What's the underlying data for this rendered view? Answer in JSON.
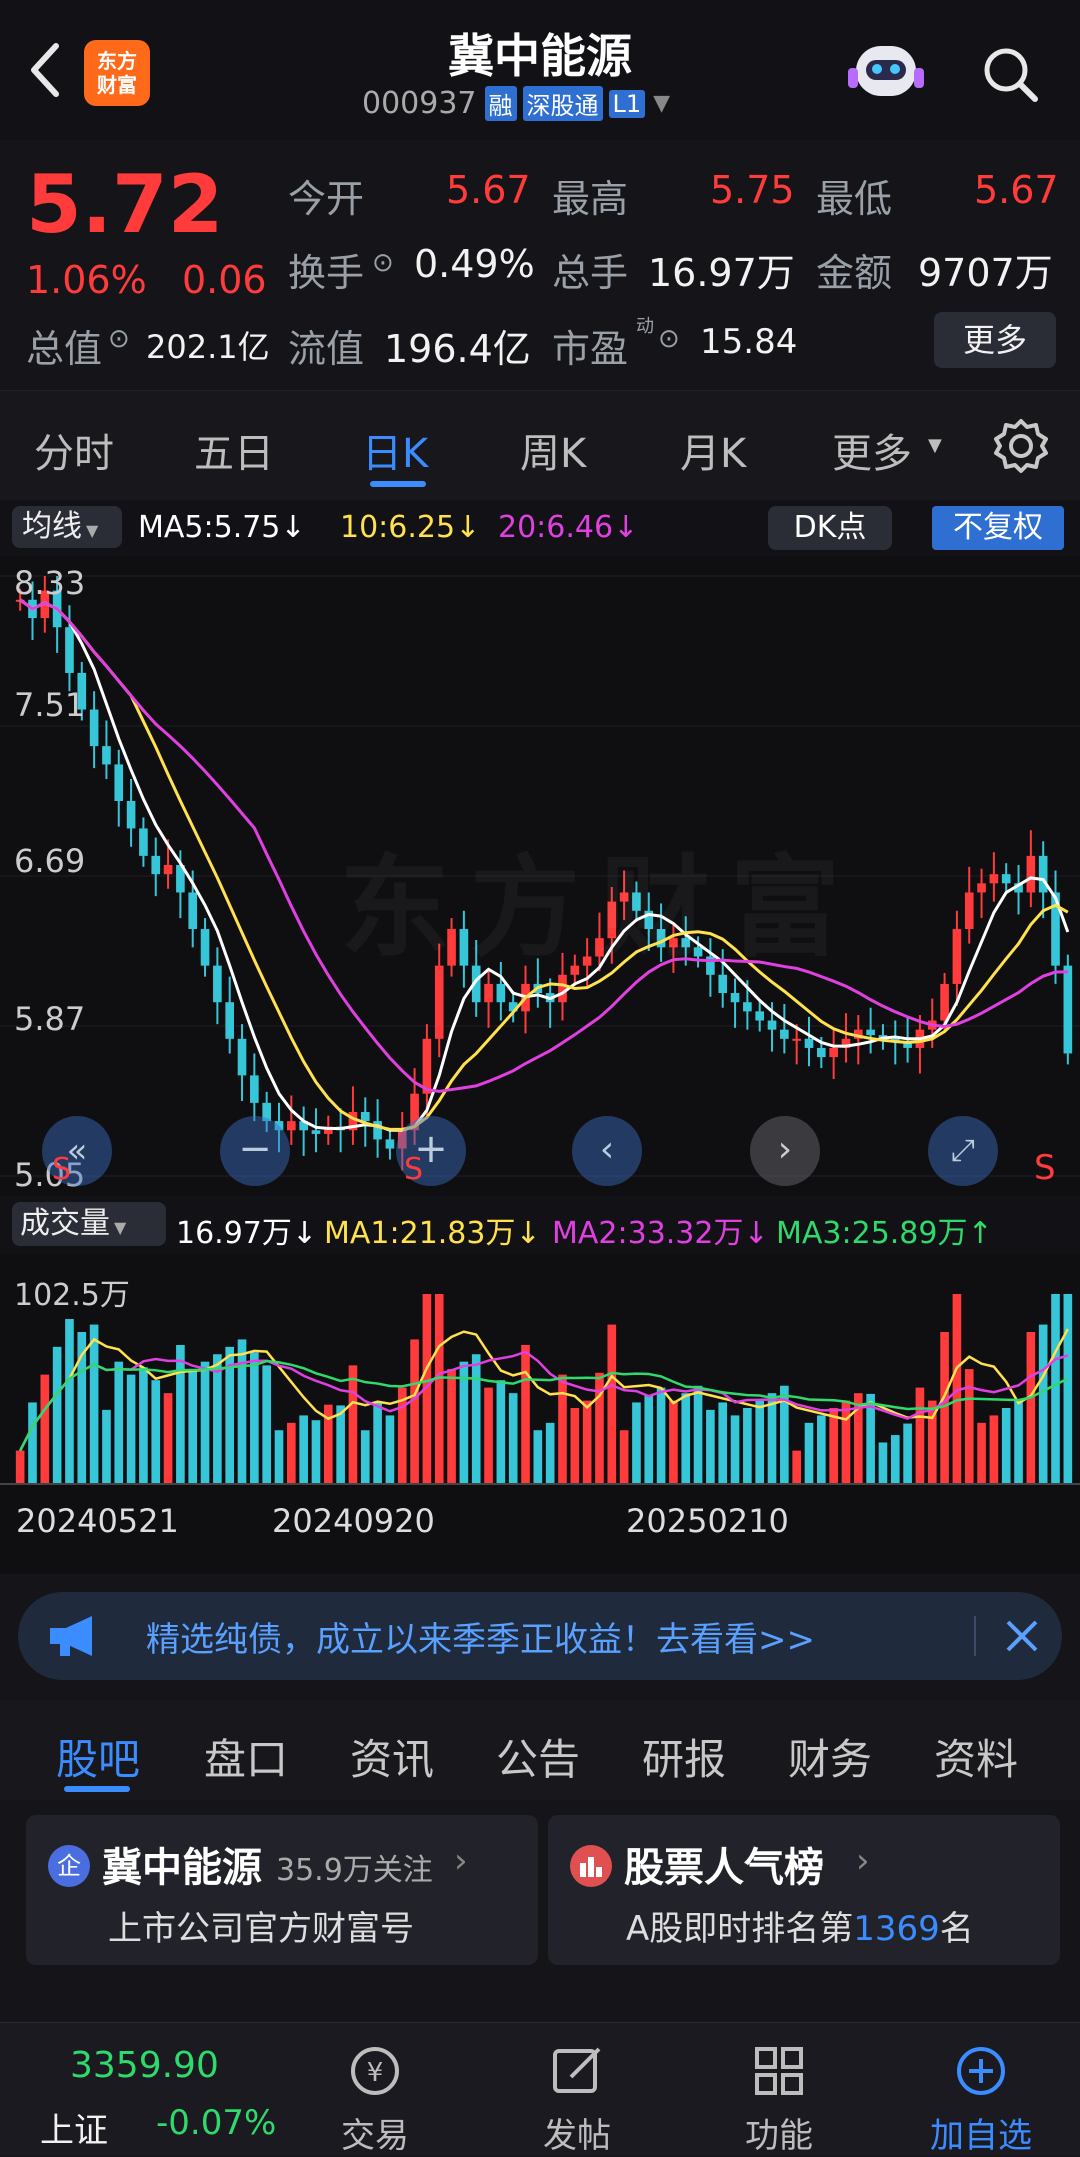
{
  "header": {
    "title": "冀中能源",
    "code": "000937",
    "tags": [
      "融",
      "深股通",
      "L1"
    ],
    "logo_text": "东方财富"
  },
  "quote": {
    "price": "5.72",
    "change_pct": "1.06%",
    "change_amt": "0.06",
    "open_label": "今开",
    "open": "5.67",
    "high_label": "最高",
    "high": "5.75",
    "low_label": "最低",
    "low": "5.67",
    "turnover_label": "换手",
    "turnover": "0.49%",
    "volume_label": "总手",
    "volume": "16.97万",
    "amount_label": "金额",
    "amount": "9707万",
    "mktcap_label": "总值",
    "mktcap": "202.1亿",
    "float_label": "流值",
    "float": "196.4亿",
    "pe_label": "市盈",
    "pe_sup": "动",
    "pe": "15.84",
    "more_button": "更多"
  },
  "tabs": [
    "分时",
    "五日",
    "日K",
    "周K",
    "月K",
    "更多"
  ],
  "active_tab": "日K",
  "chart_bar": {
    "ma_selector": "均线",
    "ma5": "MA5:5.75",
    "ma10": "10:6.25",
    "ma20": "20:6.46",
    "dk_label": "DK点",
    "adjust_label": "不复权"
  },
  "vol_bar": {
    "selector": "成交量",
    "vol": "16.97万",
    "ma1": "MA1:21.83万",
    "ma2": "MA2:33.32万",
    "ma3": "MA3:25.89万"
  },
  "colors": {
    "up": "#ff3b3b",
    "down": "#36c6d8",
    "ma5": "#ffffff",
    "ma10": "#ffe14d",
    "ma20": "#e040e0",
    "accent": "#3b8cff"
  },
  "chart_data": {
    "type": "candlestick",
    "ylim": [
      5.05,
      8.33
    ],
    "y_ticks": [
      "8.33",
      "7.51",
      "6.69",
      "5.87",
      "5.05"
    ],
    "x_ticks": [
      "20240521",
      "20240920",
      "20250210"
    ],
    "close_series": [
      8.2,
      8.1,
      8.25,
      8.05,
      7.8,
      7.6,
      7.4,
      7.3,
      7.1,
      6.95,
      6.8,
      6.7,
      6.75,
      6.6,
      6.4,
      6.2,
      6.0,
      5.8,
      5.6,
      5.45,
      5.35,
      5.3,
      5.35,
      5.3,
      5.28,
      5.32,
      5.3,
      5.4,
      5.35,
      5.25,
      5.2,
      5.3,
      5.5,
      5.8,
      6.2,
      6.4,
      6.2,
      6.0,
      6.1,
      6.0,
      5.95,
      6.1,
      6.05,
      6.0,
      6.15,
      6.2,
      6.25,
      6.35,
      6.55,
      6.6,
      6.5,
      6.4,
      6.3,
      6.35,
      6.3,
      6.25,
      6.15,
      6.05,
      6.0,
      5.95,
      5.9,
      5.85,
      5.8,
      5.8,
      5.75,
      5.7,
      5.75,
      5.8,
      5.85,
      5.82,
      5.8,
      5.78,
      5.75,
      5.85,
      5.9,
      6.1,
      6.4,
      6.6,
      6.65,
      6.7,
      6.65,
      6.6,
      6.8,
      6.6,
      6.2,
      5.72
    ],
    "volume_ylim": [
      0,
      102.5
    ],
    "volume_unit": "万",
    "volume_label": "102.5万"
  },
  "banner": {
    "text": "精选纯债，成立以来季季正收益！去看看>>"
  },
  "sub_tabs": [
    "股吧",
    "盘口",
    "资讯",
    "公告",
    "研报",
    "财务",
    "资料"
  ],
  "cards": [
    {
      "title": "冀中能源",
      "followers": "35.9万关注",
      "subtitle": "上市公司官方财富号"
    },
    {
      "title": "股票人气榜",
      "subtitle_prefix": "A股即时排名第",
      "rank": "1369",
      "subtitle_suffix": "名"
    }
  ],
  "bottom_nav": {
    "index_value": "3359.90",
    "index_name": "上证",
    "index_change": "-0.07%",
    "items": [
      "交易",
      "发帖",
      "功能",
      "加自选"
    ]
  }
}
